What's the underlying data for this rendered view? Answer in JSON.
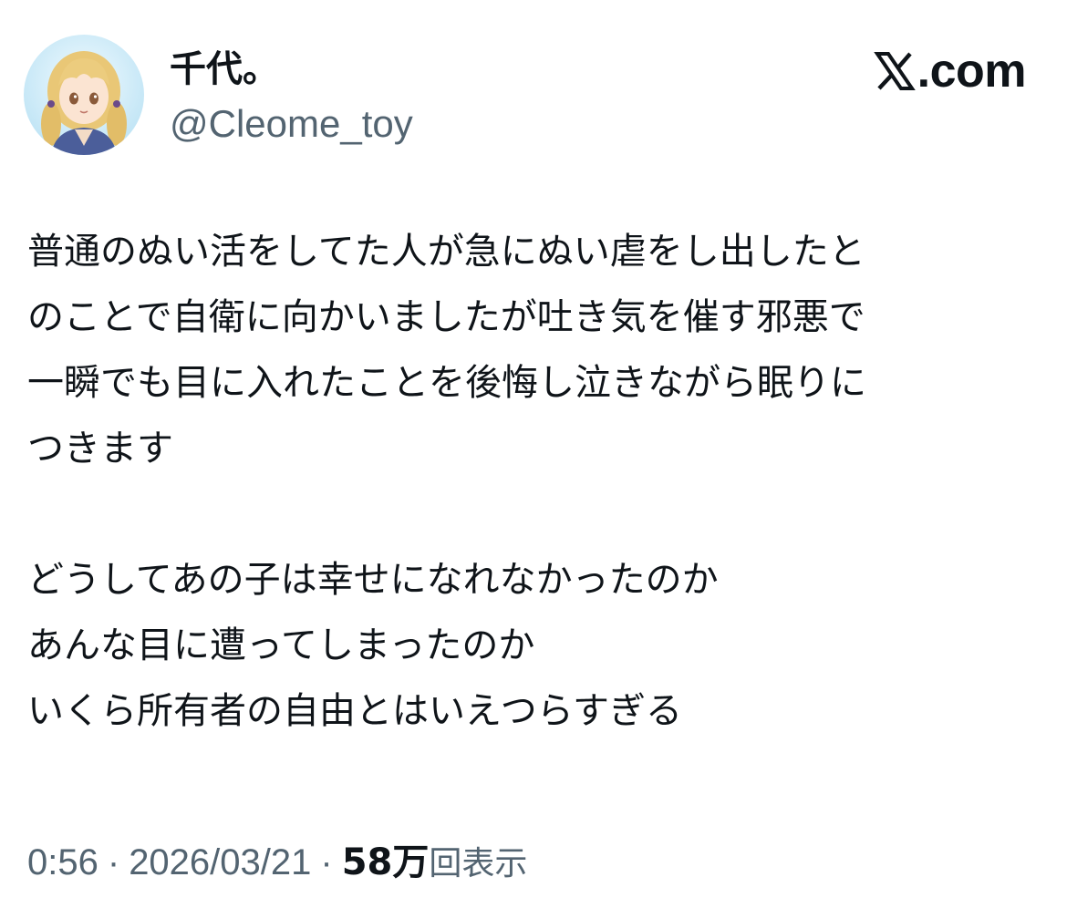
{
  "author": {
    "display_name": "千代。",
    "handle": "@Cleome_toy",
    "avatar": "anime-girl-avatar-icon"
  },
  "brand": {
    "icon": "x-logo-icon",
    "text": ".com"
  },
  "tweet": {
    "lines": [
      "普通のぬい活をしてた人が急にぬい虐をし出したと",
      "のことで自衛に向かいましたが吐き気を催す邪悪で",
      "一瞬でも目に入れたことを後悔し泣きながら眠りに",
      "つきます",
      "どうしてあの子は幸せになれなかったのか",
      "あんな目に遭ってしまったのか",
      "いくら所有者の自由とはいえつらすぎる"
    ]
  },
  "meta": {
    "time": "0:56",
    "separator": "·",
    "date": "2026/03/21",
    "views_count": "58万",
    "views_label": "回表示"
  }
}
